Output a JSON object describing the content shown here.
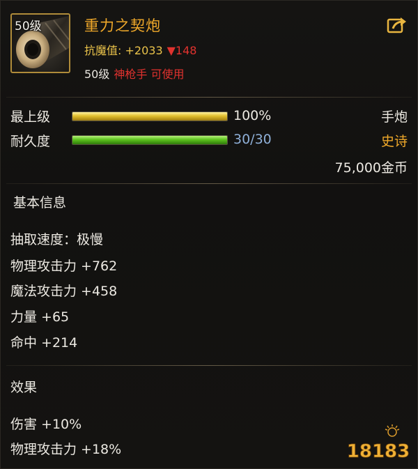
{
  "item": {
    "level_tag": "50级",
    "name": "重力之契炮",
    "resist_label": "抗魔值:",
    "resist_value": "+2033",
    "resist_change": "▼148",
    "req_level": "50级",
    "req_class": "神枪手",
    "req_usable": "可使用"
  },
  "stats": {
    "grade": {
      "label": "最上级",
      "value": "100%",
      "fill_percent": 100
    },
    "durability": {
      "label": "耐久度",
      "value": "30/30",
      "fill_percent": 100
    },
    "type": "手炮",
    "rarity": "史诗",
    "price": "75,000金币"
  },
  "basic_info": {
    "title": "基本信息",
    "attributes": [
      "抽取速度：极慢",
      "物理攻击力 +762",
      "魔法攻击力 +458",
      "力量 +65",
      "命中 +214"
    ]
  },
  "effects": {
    "title": "效果",
    "lines": [
      "伤害 +10%",
      "物理攻击力 +18%"
    ]
  },
  "watermark": {
    "text": "18183"
  },
  "colors": {
    "name": "#f0a92a",
    "resist": "#e9c24a",
    "decrease": "#e0322e",
    "rarity": "#f0a92a",
    "durability_text": "#8fb0d8",
    "grade_bar": "#e2bf2e",
    "durability_bar": "#5cc21e"
  },
  "icons": [
    "cannon-item-icon",
    "share-icon",
    "watermark-logo"
  ]
}
